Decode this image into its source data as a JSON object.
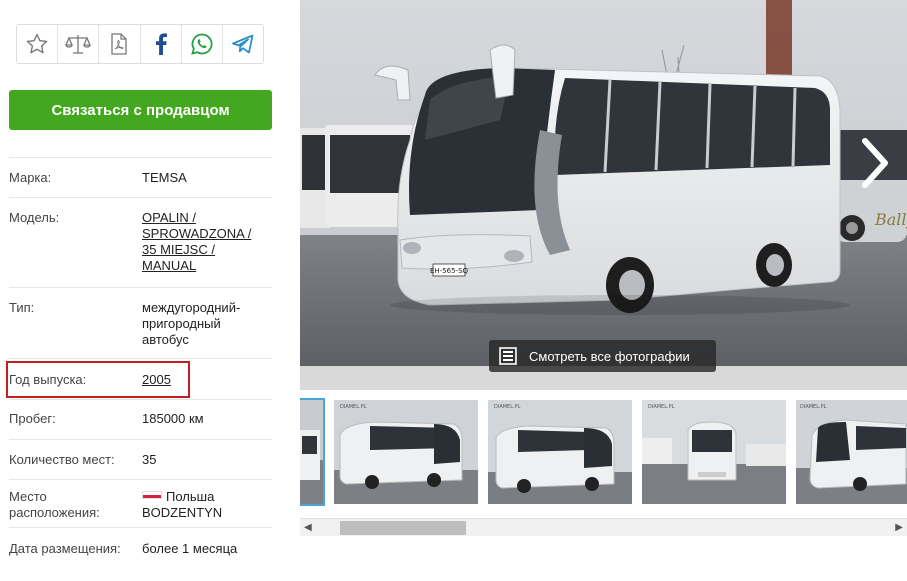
{
  "share": {
    "icons": [
      "star-icon",
      "scales-icon",
      "pdf-icon",
      "facebook-icon",
      "whatsapp-icon",
      "telegram-icon"
    ],
    "colors": {
      "facebook": "#1f4f91",
      "whatsapp": "#25a244",
      "telegram": "#2a8fc9",
      "neutral": "#777777"
    }
  },
  "contact_button": {
    "label": "Связаться с продавцом",
    "color": "#43a81f"
  },
  "params": {
    "make": {
      "label": "Марка:",
      "value": "TEMSA"
    },
    "model": {
      "label": "Модель:",
      "lines": [
        "OPALIN /",
        "SPROWADZONA /",
        "35 MIEJSC /",
        "MANUAL"
      ]
    },
    "type": {
      "label": "Тип:",
      "lines": [
        "междугородний-",
        "пригородный",
        "автобус"
      ]
    },
    "year": {
      "label": "Год выпуска:",
      "value": "2005"
    },
    "mileage": {
      "label": "Пробег:",
      "value": "185000 км"
    },
    "seats": {
      "label": "Количество мест:",
      "value": "35"
    },
    "location": {
      "label_lines": [
        "Место",
        "расположения:"
      ],
      "country": "Польша",
      "city": "BODZENTYN"
    },
    "date": {
      "label": "Дата размещения:",
      "value": "более 1 месяца"
    }
  },
  "gallery": {
    "view_all_label": "Смотреть все фотографии",
    "plate": "EH-565-SQ",
    "thumb_watermark": "DIAMEL.PL",
    "highlight_color": "#c02020"
  }
}
